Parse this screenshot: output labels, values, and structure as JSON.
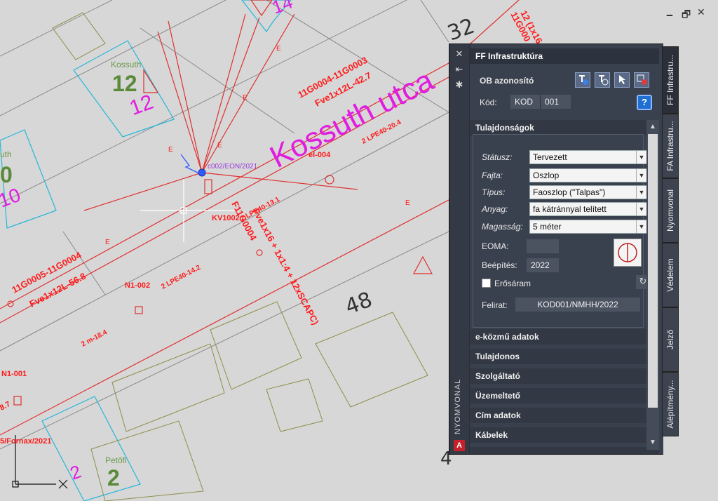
{
  "window_controls": {
    "minimize": "🗕",
    "restore": "🗗",
    "close": "✕"
  },
  "map": {
    "labels": {
      "kossuth_top": "Kossuth",
      "num_12_green": "12",
      "num_12_mag": "12",
      "street": "Kossuth utca",
      "num_14": "14",
      "num_32": "32",
      "num_48": "48",
      "petofi": "Petőfi",
      "num_2_green": "2",
      "num_2_mag": "2",
      "frag_uth": "uth",
      "frag_0": "0",
      "frag_10": "10",
      "frag_4": "4",
      "line1": "11G0004-11G0003",
      "line2": "Fve1x12L-42.7",
      "line3": "11G0005-11G0004",
      "line4": "Fve1x12L-56.8",
      "lpe_204": "2 LPE40-20.4",
      "lpe_142": "2 LPE40-14.2",
      "lpe_131": "2 LPE40-13.1",
      "m184": "2 m-18.4",
      "n1_002": "N1-002",
      "n1_001": "N1-001",
      "el_004": "el-004",
      "eon": "c002/EON/2021",
      "kv": "KV1002",
      "vert": "F11G0004",
      "fornax": "5/Fornax/2021",
      "cable": "Fve1x16 + 1x1:4 + 12xSCAPC)",
      "top_right": "12 (1x16",
      "top_right2": "11G000",
      "frag_87": "8.7",
      "e": "E"
    }
  },
  "palette": {
    "strip_title": "NYOMVONAL",
    "strip_icons": {
      "close": "✕",
      "pin": "⇤",
      "settings": "✱"
    },
    "logo": "A",
    "title": "FF Infrastruktúra",
    "ob_label": "OB azonosító",
    "tool_icons": [
      "add-object-icon",
      "select-object-icon",
      "pick-icon",
      "delete-icon"
    ],
    "kod_label": "Kód:",
    "kod_prefix": "KOD",
    "kod_number": "001",
    "help": "?",
    "sections": {
      "tulajdonsagok": "Tulajdonságok",
      "ekozmu": "e-közmű adatok",
      "tulajdonos": "Tulajdonos",
      "szolgaltato": "Szolgáltató",
      "uzemelteto": "Üzemeltető",
      "cim": "Cím adatok",
      "kabelek": "Kábelek"
    },
    "fields": {
      "statusz": {
        "label": "Státusz:",
        "value": "Tervezett"
      },
      "fajta": {
        "label": "Fajta:",
        "value": "Oszlop"
      },
      "tipus": {
        "label": "Típus:",
        "value": "Faoszlop (\"Talpas\")"
      },
      "anyag": {
        "label": "Anyag:",
        "value": "fa kátránnyal telített"
      },
      "magassag": {
        "label": "Magasság:",
        "value": "5 méter"
      },
      "eoma": {
        "label": "EOMA:",
        "value": ""
      },
      "beepites": {
        "label": "Beépítés:",
        "value": "2022"
      },
      "erosaram": {
        "label": "Erősáram",
        "checked": false
      },
      "felirat": {
        "label": "Felirat:",
        "value": "KOD001/NMHH/2022"
      }
    }
  },
  "tabs": [
    "FF Infrastru...",
    "FA Infrastru...",
    "Nyomvonal",
    "Védelem",
    "Jelző",
    "Alépítmény..."
  ]
}
